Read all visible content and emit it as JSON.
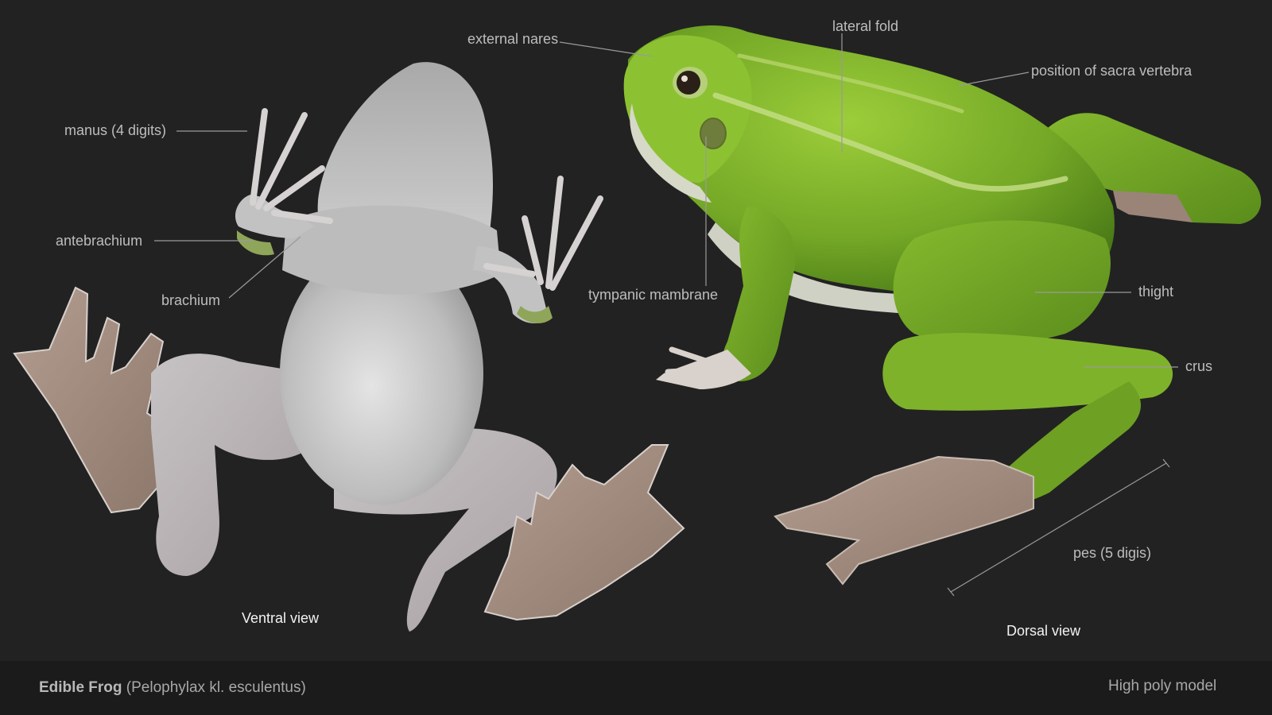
{
  "labels": {
    "manus": "manus (4 digits)",
    "antebrachium": "antebrachium",
    "brachium": "brachium",
    "external_nares": "external nares",
    "lateral_fold": "lateral fold",
    "sacral_vertebra": "position of sacra vertebra",
    "tympanic": "tympanic mambrane",
    "thigh": "thight",
    "crus": "crus",
    "pes": "pes (5 digis)"
  },
  "views": {
    "ventral": "Ventral view",
    "dorsal": "Dorsal view"
  },
  "footer": {
    "common_name": "Edible Frog",
    "scientific_name": "(Pelophylax kl. esculentus)",
    "model_note": "High poly model"
  },
  "colors": {
    "background": "#222222",
    "footer_bar": "#1b1b1b",
    "frog_green": "#7fb52a",
    "ventral_skin": "#c9c9c9",
    "webbing": "#a08a7c",
    "label_text": "#bdbdbd",
    "leader_line": "#9a9a9a"
  }
}
